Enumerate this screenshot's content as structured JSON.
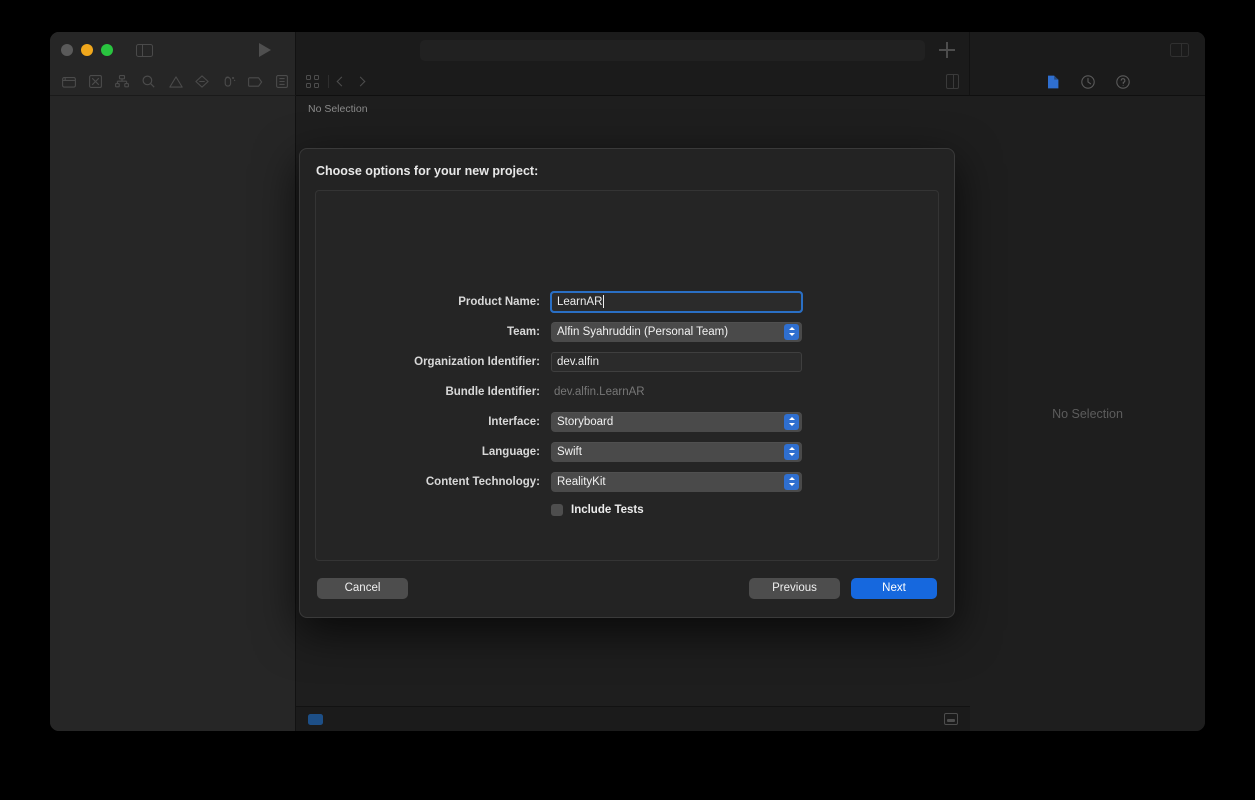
{
  "window": {
    "traffic_lights": [
      "close",
      "minimize",
      "zoom"
    ],
    "toolbar": {
      "navigator_toggle_icon": "sidebar-left-icon",
      "run_icon": "play-icon",
      "add_icon": "plus-icon",
      "inspector_toggle_icon": "sidebar-right-icon",
      "navigator_icons": [
        "folder-icon",
        "source-control-icon",
        "symbol-hierarchy-icon",
        "search-icon",
        "issue-warning-icon",
        "test-diamond-icon",
        "debug-icon",
        "breakpoint-icon",
        "report-icon"
      ]
    },
    "jumpbar": {
      "grid_icon": "grid-icon",
      "back_icon": "chevron-left-icon",
      "forward_icon": "chevron-right-icon",
      "split_editor_icon": "split-editor-icon",
      "breadcrumb": "No Selection"
    },
    "inspector": {
      "tabs": [
        "file-inspector-icon",
        "history-inspector-icon",
        "quick-help-icon"
      ],
      "selected_tab": "file-inspector-icon",
      "empty_message": "No Selection"
    },
    "statusbar": {
      "filter_icon": "filter-tag-icon",
      "console_icon": "console-toggle-icon"
    }
  },
  "sheet": {
    "title": "Choose options for your new project:",
    "fields": [
      {
        "label": "Product Name:",
        "type": "textfield",
        "value": "LearnAR",
        "focused": true
      },
      {
        "label": "Team:",
        "type": "popup",
        "value": "Alfin Syahruddin (Personal Team)"
      },
      {
        "label": "Organization Identifier:",
        "type": "textfield",
        "value": "dev.alfin",
        "focused": false
      },
      {
        "label": "Bundle Identifier:",
        "type": "static",
        "value": "dev.alfin.LearnAR"
      },
      {
        "label": "Interface:",
        "type": "popup",
        "value": "Storyboard"
      },
      {
        "label": "Language:",
        "type": "popup",
        "value": "Swift"
      },
      {
        "label": "Content Technology:",
        "type": "popup",
        "value": "RealityKit"
      }
    ],
    "checkbox": {
      "label": "Include Tests",
      "checked": false
    },
    "buttons": {
      "cancel": "Cancel",
      "previous": "Previous",
      "next": "Next"
    }
  },
  "colors": {
    "accent_blue": "#1668de",
    "stepper_blue": "#2f6fd0",
    "focus_ring": "#2a6fc4",
    "window_bg": "#1e1e1e",
    "sheet_bg": "#232323",
    "light_yellow": "#f0a71c",
    "light_green": "#29c43f"
  }
}
